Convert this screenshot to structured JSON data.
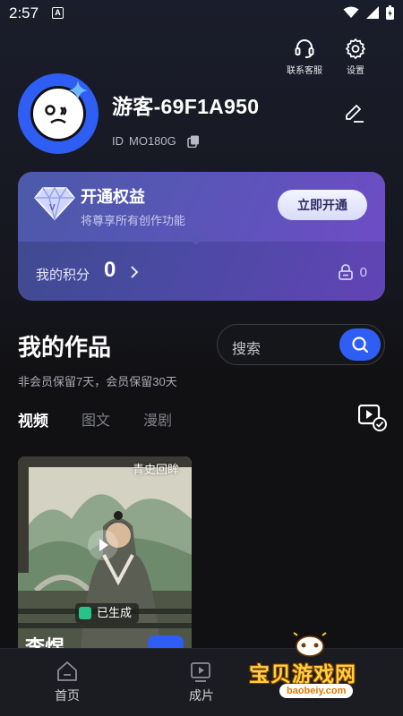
{
  "status_bar": {
    "time": "2:57",
    "notification_letter": "A"
  },
  "top_actions": {
    "support_label": "联系客服",
    "settings_label": "设置"
  },
  "profile": {
    "username": "游客-69F1A950",
    "id_prefix": "ID",
    "id_value": "MO180G"
  },
  "vip": {
    "title": "开通权益",
    "subtitle": "将尊享所有创作功能",
    "button_label": "立即开通",
    "points_label": "我的积分",
    "points_value": "0",
    "locked_value": "0"
  },
  "works": {
    "title": "我的作品",
    "note": "非会员保留7天，会员保留30天",
    "search_placeholder": "搜索",
    "tabs": [
      {
        "label": "视频",
        "active": true
      },
      {
        "label": "图文",
        "active": false
      },
      {
        "label": "漫剧",
        "active": false
      }
    ],
    "items": [
      {
        "tag": "青史回眸",
        "status": "已生成",
        "caption": "李煜"
      }
    ]
  },
  "bottom_nav": {
    "items": [
      {
        "label": "首页"
      },
      {
        "label": "成片"
      }
    ]
  },
  "watermark": {
    "text": "宝贝游戏网",
    "url": "baobeiy.com"
  },
  "colors": {
    "accent": "#2f5ef5",
    "background": "#111113",
    "vip_card": "#4a4aa2",
    "success": "#27c48a"
  }
}
